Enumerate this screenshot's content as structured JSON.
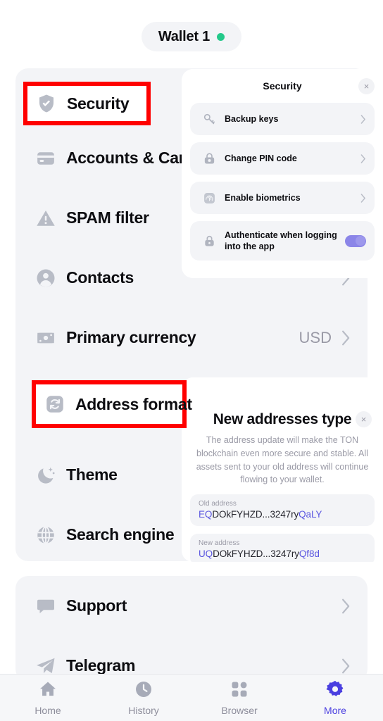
{
  "header": {
    "wallet_name": "Wallet 1",
    "status_dot_color": "#24c98a"
  },
  "theme": {
    "accent": "#4a3fe0",
    "toggle_on": "#8b85e8",
    "link": "#5b57e0",
    "annotation": "#ff0000",
    "card_bg": "#f3f4f7",
    "muted_text": "#9a9aa6"
  },
  "settings": {
    "main_items": [
      {
        "id": "security",
        "label": "Security",
        "icon": "shield-check-icon",
        "value": "",
        "chevron": false
      },
      {
        "id": "accounts-cards",
        "label": "Accounts & Cards",
        "icon": "credit-card-icon",
        "value": "",
        "chevron": false
      },
      {
        "id": "spam-filter",
        "label": "SPAM filter",
        "icon": "warning-triangle-icon",
        "value": "",
        "chevron": false
      },
      {
        "id": "contacts",
        "label": "Contacts",
        "icon": "person-circle-icon",
        "value": "",
        "chevron": true
      },
      {
        "id": "primary-currency",
        "label": "Primary currency",
        "icon": "banknote-icon",
        "value": "USD",
        "chevron": true
      },
      {
        "id": "address-format",
        "label": "Address format",
        "icon": "refresh-icon",
        "value": "",
        "chevron": false
      },
      {
        "id": "theme",
        "label": "Theme",
        "icon": "moon-stars-icon",
        "value": "",
        "chevron": false
      },
      {
        "id": "search-engine",
        "label": "Search engine",
        "icon": "globe-icon",
        "value": "",
        "chevron": false
      }
    ],
    "link_items": [
      {
        "id": "support",
        "label": "Support",
        "icon": "chat-bubble-icon",
        "chevron": true
      },
      {
        "id": "telegram",
        "label": "Telegram",
        "icon": "telegram-plane-icon",
        "chevron": true
      }
    ]
  },
  "security_sheet": {
    "title": "Security",
    "close_label": "×",
    "rows": [
      {
        "id": "backup-keys",
        "label": "Backup keys",
        "icon": "key-icon",
        "control": "chevron"
      },
      {
        "id": "change-pin-code",
        "label": "Change PIN code",
        "icon": "lock-refresh-icon",
        "control": "chevron"
      },
      {
        "id": "enable-biometrics",
        "label": "Enable biometrics",
        "icon": "fingerprint-icon",
        "control": "chevron"
      },
      {
        "id": "authenticate-login",
        "label": "Authenticate when logging into the app",
        "icon": "lock-icon",
        "control": "toggle",
        "toggle_on": true
      }
    ]
  },
  "address_sheet": {
    "title": "New addresses type",
    "description": "The address update will make the TON blockchain even more secure and stable. All assets sent to your old address will continue flowing to your wallet.",
    "close_label": "×",
    "old_address": {
      "label": "Old address",
      "prefix": "EQ",
      "middle": "DOkFYHZD...3247ry",
      "suffix": "QaLY"
    },
    "new_address": {
      "label": "New address",
      "prefix": "UQ",
      "middle": "DOkFYHZD...3247ry",
      "suffix": "Qf8d"
    }
  },
  "bottom_nav": {
    "items": [
      {
        "id": "home",
        "label": "Home",
        "icon": "home-icon",
        "active": false
      },
      {
        "id": "history",
        "label": "History",
        "icon": "clock-icon",
        "active": false
      },
      {
        "id": "browser",
        "label": "Browser",
        "icon": "grid-icon",
        "active": false
      },
      {
        "id": "more",
        "label": "More",
        "icon": "gear-icon",
        "active": true
      }
    ]
  },
  "annotations": [
    {
      "id": "security-highlight",
      "target": "Security"
    },
    {
      "id": "address-format-highlight",
      "target": "Address format"
    }
  ]
}
